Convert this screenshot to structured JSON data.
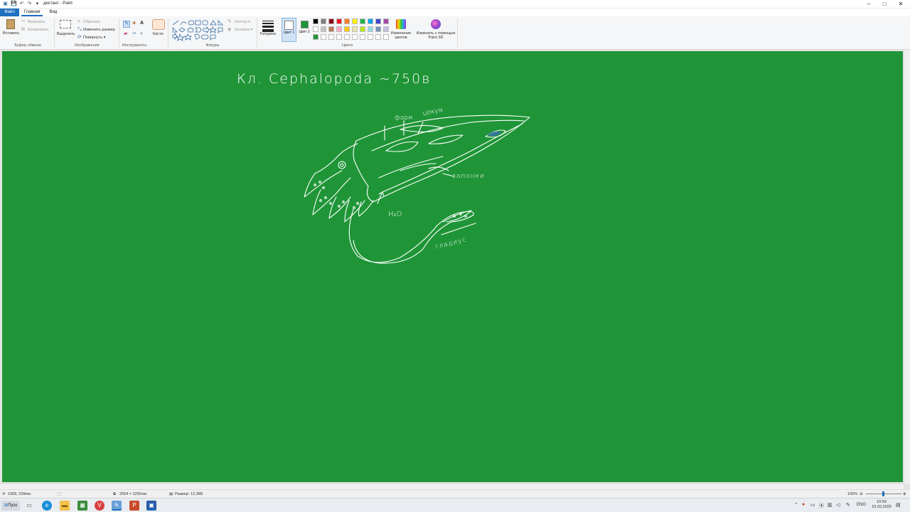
{
  "window": {
    "title": "дистант - Paint",
    "minimize": "–",
    "maximize": "□",
    "close": "✕"
  },
  "quick_access": [
    "save-icon",
    "undo-icon",
    "redo-icon",
    "customize-icon"
  ],
  "menu": {
    "file": "Файл",
    "home": "Главная",
    "view": "Вид"
  },
  "ribbon": {
    "clipboard": {
      "paste": "Вставить",
      "cut": "Вырезать",
      "copy": "Копировать",
      "group": "Буфер обмена"
    },
    "image": {
      "select": "Выделить",
      "crop": "Обрезать",
      "resize": "Изменить размер",
      "rotate": "Повернуть ▾",
      "group": "Изображение"
    },
    "tools": {
      "group": "Инструменты",
      "text_tool": "A"
    },
    "brushes": {
      "label": "Кисти"
    },
    "shapes": {
      "outline": "Контур ▾",
      "fill": "Заливка ▾",
      "group": "Фигуры"
    },
    "thickness": {
      "label": "Толщина"
    },
    "colors": {
      "color1": "Цвет 1",
      "color2": "Цвет 2",
      "edit": "Изменение цветов",
      "paint3d": "Изменить с помощью Paint 3D",
      "group": "Цвета",
      "color1_value": "#ffffff",
      "color2_value": "#1f9537",
      "palette": [
        "#000000",
        "#7f7f7f",
        "#880015",
        "#ed1c24",
        "#ff7f27",
        "#fff200",
        "#22b14c",
        "#00a2e8",
        "#3f48cc",
        "#a349a4",
        "#ffffff",
        "#c3c3c3",
        "#b97a57",
        "#ffaec9",
        "#ffc90e",
        "#efe4b0",
        "#b5e61d",
        "#99d9ea",
        "#7092be",
        "#c8bfe7",
        "#1f9537",
        "#ffffff",
        "#ffffff",
        "#ffffff",
        "#ffffff",
        "#ffffff",
        "#ffffff",
        "#ffffff",
        "#ffffff",
        "#ffffff"
      ]
    }
  },
  "canvas": {
    "background": "#1f9537",
    "drawing": {
      "heading": "Кл. Cephalopoda ~750в",
      "label_farm": "фарм.",
      "label_cecum": "цекум",
      "label_zaponki": "запонки",
      "label_h2o": "H₂O",
      "label_gladius": "гладиус"
    }
  },
  "status": {
    "cursor_pos": "1309, 239пкс",
    "selection": "",
    "dimensions": "2554 × 1292пкс",
    "size": "Размер: 12,3КБ",
    "zoom": "100%"
  },
  "taskbar": {
    "start": "Пуск",
    "lang": "ENG",
    "time": "10:59",
    "date": "15.02.2025"
  }
}
